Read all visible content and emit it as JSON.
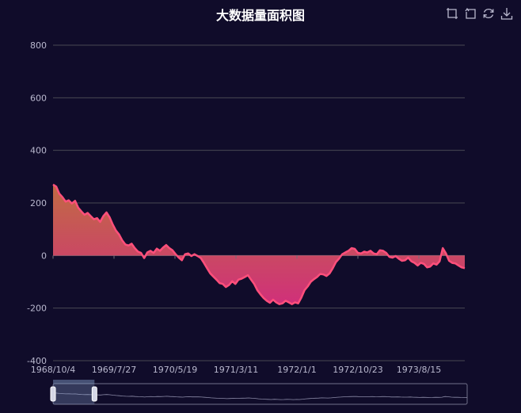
{
  "toolbox": {
    "icons": [
      "zoom-icon",
      "zoom-reset-icon",
      "restore-icon",
      "save-image-icon"
    ]
  },
  "chart_data": {
    "type": "area",
    "title": "大数据量面积图",
    "xlabel": "",
    "ylabel": "",
    "ylim": [
      -400,
      800
    ],
    "yticks": [
      -400,
      -200,
      0,
      200,
      400,
      600,
      800
    ],
    "xticks": [
      "1968/10/4",
      "1969/7/27",
      "1970/5/19",
      "1971/3/11",
      "1972/1/1",
      "1972/10/23",
      "1973/8/15"
    ],
    "grid": true,
    "legend": "none",
    "colors": {
      "line": "#ff4f7b",
      "area_top": "#c16b43",
      "area_bottom": "#d0307a",
      "background": "#100c2a"
    },
    "series": [
      {
        "x_start": "1968/10/4",
        "x_end": "1974/3/20",
        "values": [
          270,
          262,
          235,
          222,
          205,
          210,
          198,
          208,
          182,
          168,
          155,
          162,
          150,
          138,
          142,
          128,
          150,
          164,
          145,
          118,
          95,
          80,
          58,
          42,
          38,
          45,
          28,
          15,
          10,
          -10,
          12,
          18,
          10,
          26,
          18,
          30,
          40,
          28,
          20,
          5,
          -8,
          -18,
          5,
          8,
          -2,
          5,
          -2,
          -10,
          -28,
          -48,
          -68,
          -80,
          -92,
          -105,
          -108,
          -120,
          -112,
          -98,
          -108,
          -92,
          -88,
          -82,
          -75,
          -92,
          -108,
          -132,
          -148,
          -162,
          -172,
          -180,
          -168,
          -178,
          -185,
          -182,
          -172,
          -178,
          -185,
          -178,
          -182,
          -160,
          -132,
          -118,
          -100,
          -90,
          -82,
          -70,
          -72,
          -78,
          -68,
          -48,
          -25,
          -12,
          5,
          12,
          18,
          28,
          25,
          10,
          8,
          15,
          12,
          18,
          8,
          5,
          20,
          18,
          10,
          -5,
          -8,
          -2,
          -12,
          -20,
          -18,
          -8,
          -22,
          -28,
          -38,
          -28,
          -32,
          -45,
          -42,
          -30,
          -35,
          -22,
          28,
          8,
          -20,
          -28,
          -30,
          -38,
          -45,
          -48
        ]
      }
    ],
    "datazoom": {
      "start_percent": 0,
      "end_percent": 10
    }
  }
}
